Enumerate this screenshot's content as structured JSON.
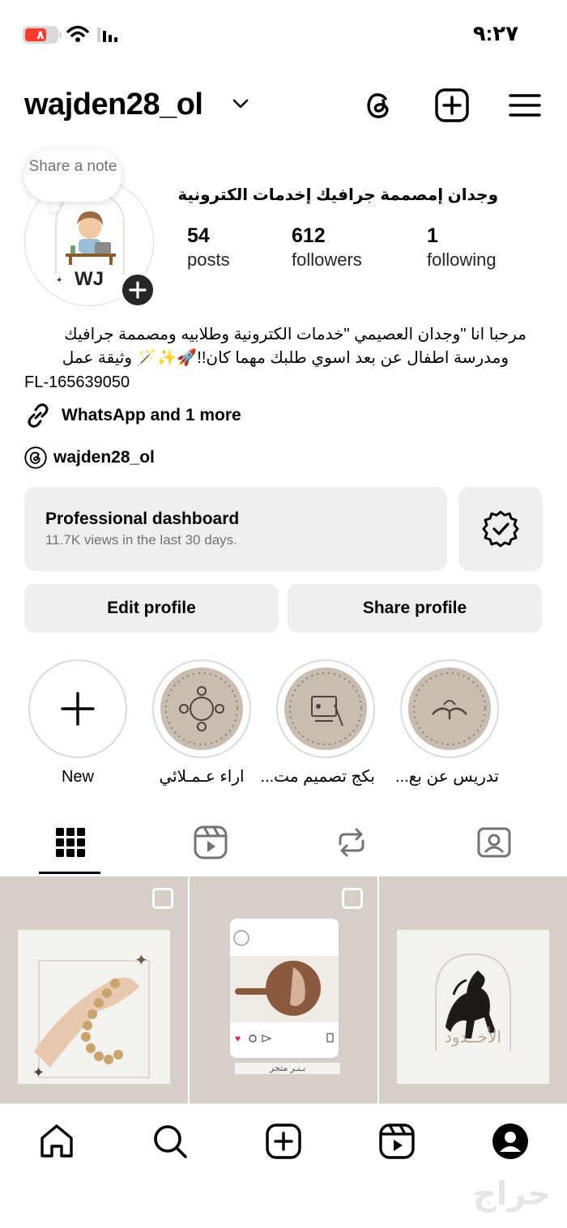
{
  "status_bar": {
    "time": "٩:٢٧",
    "battery": "٨"
  },
  "header": {
    "username": "wajden28_ol"
  },
  "profile": {
    "note": "Share a note",
    "avatar_initials": "WJ",
    "display_name": "وجدان إمصممة جرافيك إخدمات الكترونية",
    "stats": [
      {
        "value": "54",
        "label": "posts"
      },
      {
        "value": "612",
        "label": "followers"
      },
      {
        "value": "1",
        "label": "following"
      }
    ],
    "bio_line1": "مرحبا انا \"وجدان العصيمي \"خدمات الكترونية وطلابيه ومصممة جرافيك",
    "bio_line2": "ومدرسة اطفال عن بعد اسوي طلبك مهما كان!!🚀✨🪄 وثيقة عمل",
    "bio_line3": "FL-165639050",
    "links": "WhatsApp and 1 more",
    "threads_handle": "wajden28_ol"
  },
  "dashboard": {
    "title": "Professional dashboard",
    "subtitle": "11.7K views in the last 30 days."
  },
  "buttons": {
    "edit": "Edit profile",
    "share": "Share profile"
  },
  "highlights": [
    {
      "label": "New"
    },
    {
      "label": "اراء عـمـلائي"
    },
    {
      "label": "بكج تصميم مت..."
    },
    {
      "label": "تدريس عن بع..."
    }
  ],
  "posts": [
    {
      "caption": ""
    },
    {
      "caption": "بـنـر متجر"
    },
    {
      "caption": "الأخــدود"
    }
  ],
  "watermark": "حراج",
  "colors": {
    "accent": "#0095f6",
    "surface": "#efefef",
    "battery": "#ff3b30"
  }
}
